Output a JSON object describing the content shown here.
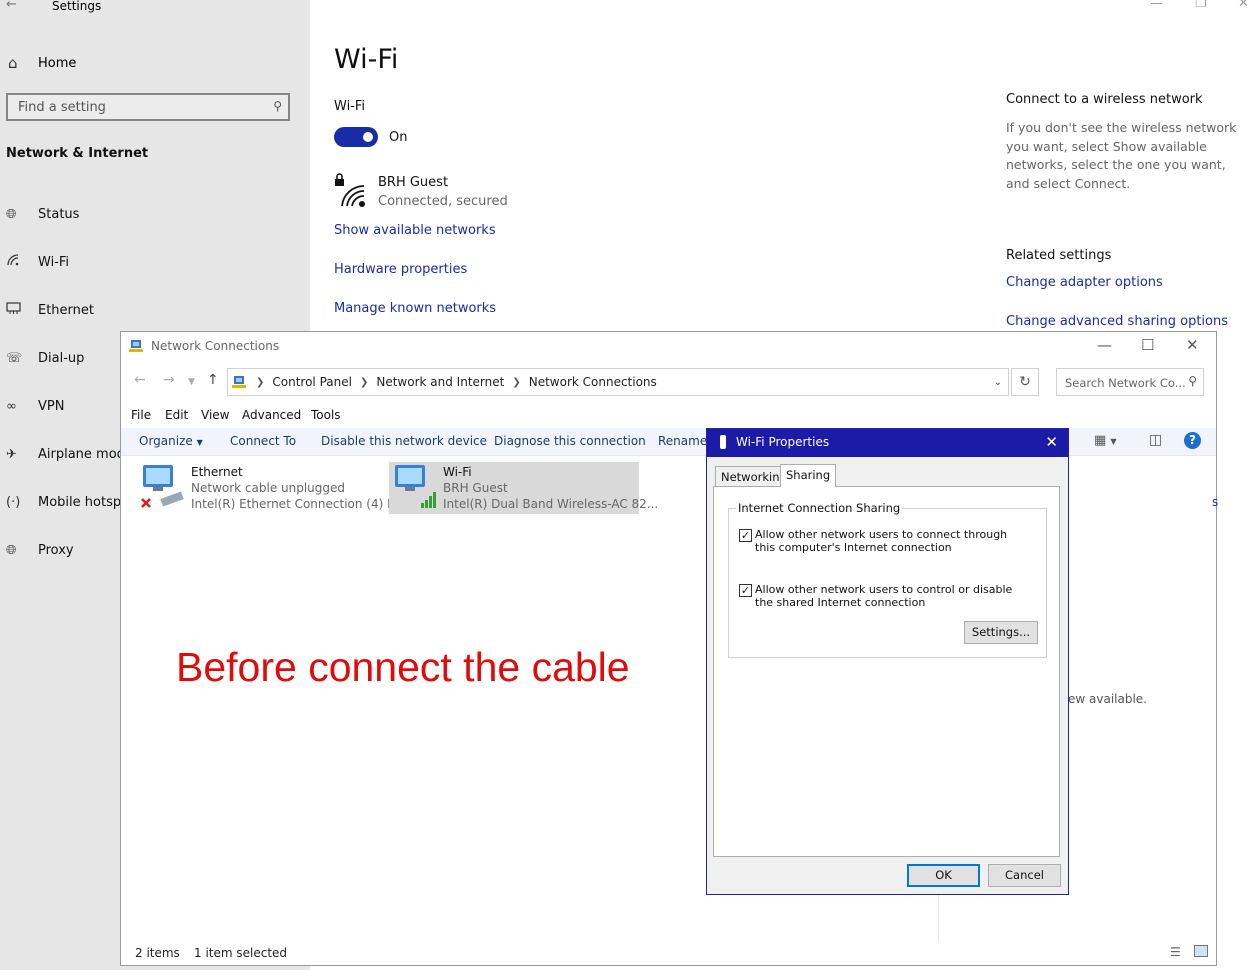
{
  "settings": {
    "window_title": "Settings",
    "home_label": "Home",
    "search_placeholder": "Find a setting",
    "section_title": "Network & Internet",
    "nav": [
      {
        "label": "Status",
        "icon": "globe-icon"
      },
      {
        "label": "Wi-Fi",
        "icon": "wifi-icon"
      },
      {
        "label": "Ethernet",
        "icon": "ethernet-icon"
      },
      {
        "label": "Dial-up",
        "icon": "dialup-icon"
      },
      {
        "label": "VPN",
        "icon": "vpn-icon"
      },
      {
        "label": "Airplane mod",
        "icon": "airplane-icon"
      },
      {
        "label": "Mobile hotsp",
        "icon": "hotspot-icon"
      },
      {
        "label": "Proxy",
        "icon": "globe-icon"
      }
    ],
    "page_title": "Wi-Fi",
    "wifi_label": "Wi-Fi",
    "toggle_state": "On",
    "network_name": "BRH Guest",
    "network_status": "Connected, secured",
    "links": [
      "Show available networks",
      "Hardware properties",
      "Manage known networks"
    ],
    "right_heading": "Connect to a wireless network",
    "right_text": "If you don't see the wireless network you want, select Show available networks, select the one you want, and select Connect.",
    "related_heading": "Related settings",
    "related_links": [
      "Change adapter options",
      "Change advanced sharing options"
    ],
    "accent": "#1a2ba8"
  },
  "network_connections": {
    "title": "Network Connections",
    "breadcrumbs": [
      "Control Panel",
      "Network and Internet",
      "Network Connections"
    ],
    "search_placeholder": "Search Network Co...",
    "menu": [
      "File",
      "Edit",
      "View",
      "Advanced",
      "Tools"
    ],
    "commands": [
      "Organize",
      "Connect To",
      "Disable this network device",
      "Diagnose this connection",
      "Rename t"
    ],
    "connections": [
      {
        "name": "Ethernet",
        "status": "Network cable unplugged",
        "adapter": "Intel(R) Ethernet Connection (4) I..."
      },
      {
        "name": "Wi-Fi",
        "status": "BRH Guest",
        "adapter": "Intel(R) Dual Band Wireless-AC 82..."
      }
    ],
    "overlay_text": "Before connect the cable",
    "overlay_color": "#e00b0b",
    "status_items": "2 items",
    "status_selected": "1 item selected",
    "background_fragment_1": "s",
    "background_fragment_2": "ew available."
  },
  "wifi_properties": {
    "title": "Wi-Fi Properties",
    "tabs": [
      "Networking",
      "Sharing"
    ],
    "active_tab": "Sharing",
    "group_label": "Internet Connection Sharing",
    "option1": "Allow other network users to connect through this computer's Internet connection",
    "option1_checked": true,
    "option2": "Allow other network users to control or disable the shared Internet connection",
    "option2_checked": true,
    "settings_button": "Settings...",
    "ok_button": "OK",
    "cancel_button": "Cancel"
  }
}
